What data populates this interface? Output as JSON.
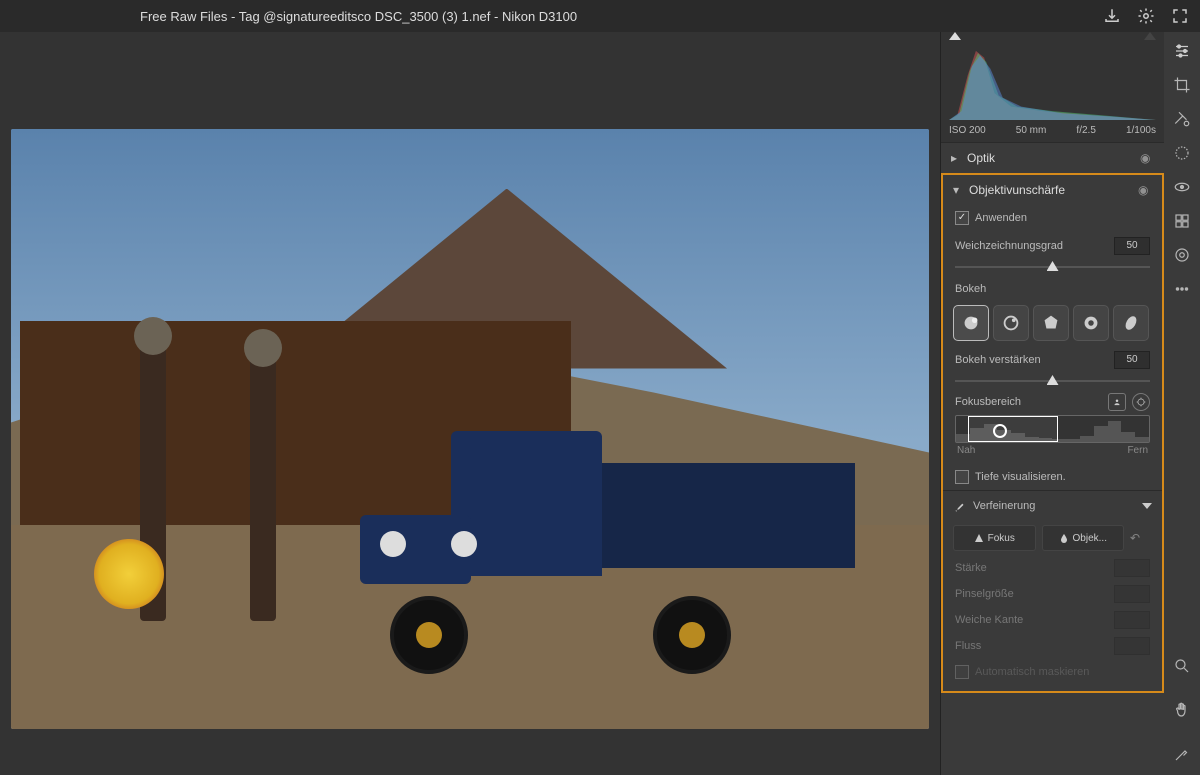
{
  "topbar": {
    "title": "Free Raw Files - Tag @signatureeditsco DSC_3500 (3) 1.nef - Nikon D3100"
  },
  "histogram": {
    "iso": "ISO 200",
    "focal": "50 mm",
    "aperture": "f/2.5",
    "shutter": "1/100s"
  },
  "panel_optik": {
    "title": "Optik"
  },
  "panel_lensblur": {
    "title": "Objektivunschärfe",
    "apply_label": "Anwenden",
    "blur_label": "Weichzeichnungsgrad",
    "blur_value": "50",
    "bokeh_label": "Bokeh",
    "bokeh_boost_label": "Bokeh verstärken",
    "bokeh_boost_value": "50",
    "focus_label": "Fokusbereich",
    "near_label": "Nah",
    "far_label": "Fern",
    "visualize_label": "Tiefe visualisieren."
  },
  "panel_refine": {
    "title": "Verfeinerung",
    "focus_btn": "Fokus",
    "blur_btn": "Objek...",
    "strength": "Stärke",
    "brush_size": "Pinselgröße",
    "soft_edge": "Weiche Kante",
    "flow": "Fluss",
    "automask": "Automatisch maskieren"
  }
}
